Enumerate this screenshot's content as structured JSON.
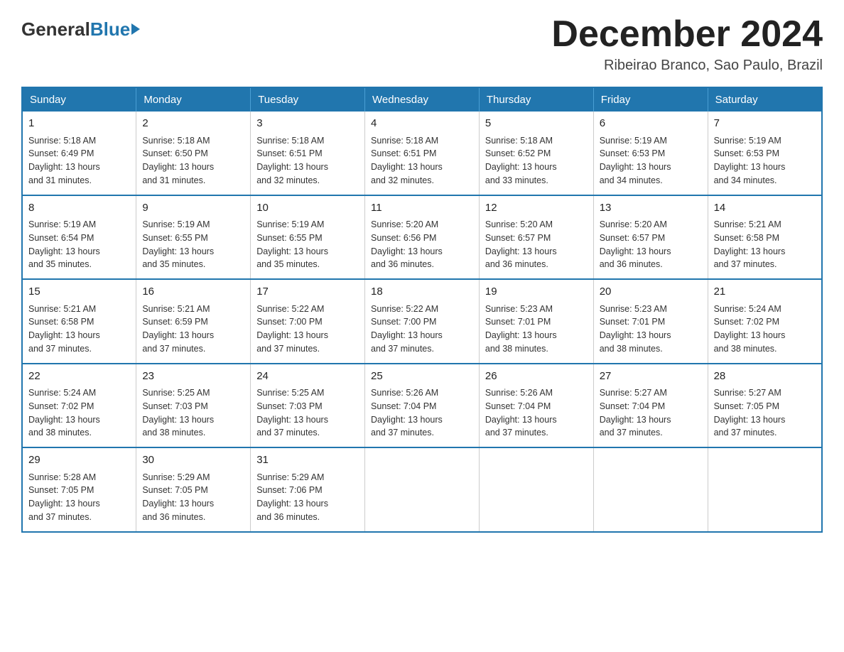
{
  "logo": {
    "general": "General",
    "blue": "Blue"
  },
  "title": "December 2024",
  "subtitle": "Ribeirao Branco, Sao Paulo, Brazil",
  "weekdays": [
    "Sunday",
    "Monday",
    "Tuesday",
    "Wednesday",
    "Thursday",
    "Friday",
    "Saturday"
  ],
  "weeks": [
    [
      {
        "day": "1",
        "sunrise": "5:18 AM",
        "sunset": "6:49 PM",
        "daylight": "13 hours and 31 minutes."
      },
      {
        "day": "2",
        "sunrise": "5:18 AM",
        "sunset": "6:50 PM",
        "daylight": "13 hours and 31 minutes."
      },
      {
        "day": "3",
        "sunrise": "5:18 AM",
        "sunset": "6:51 PM",
        "daylight": "13 hours and 32 minutes."
      },
      {
        "day": "4",
        "sunrise": "5:18 AM",
        "sunset": "6:51 PM",
        "daylight": "13 hours and 32 minutes."
      },
      {
        "day": "5",
        "sunrise": "5:18 AM",
        "sunset": "6:52 PM",
        "daylight": "13 hours and 33 minutes."
      },
      {
        "day": "6",
        "sunrise": "5:19 AM",
        "sunset": "6:53 PM",
        "daylight": "13 hours and 34 minutes."
      },
      {
        "day": "7",
        "sunrise": "5:19 AM",
        "sunset": "6:53 PM",
        "daylight": "13 hours and 34 minutes."
      }
    ],
    [
      {
        "day": "8",
        "sunrise": "5:19 AM",
        "sunset": "6:54 PM",
        "daylight": "13 hours and 35 minutes."
      },
      {
        "day": "9",
        "sunrise": "5:19 AM",
        "sunset": "6:55 PM",
        "daylight": "13 hours and 35 minutes."
      },
      {
        "day": "10",
        "sunrise": "5:19 AM",
        "sunset": "6:55 PM",
        "daylight": "13 hours and 35 minutes."
      },
      {
        "day": "11",
        "sunrise": "5:20 AM",
        "sunset": "6:56 PM",
        "daylight": "13 hours and 36 minutes."
      },
      {
        "day": "12",
        "sunrise": "5:20 AM",
        "sunset": "6:57 PM",
        "daylight": "13 hours and 36 minutes."
      },
      {
        "day": "13",
        "sunrise": "5:20 AM",
        "sunset": "6:57 PM",
        "daylight": "13 hours and 36 minutes."
      },
      {
        "day": "14",
        "sunrise": "5:21 AM",
        "sunset": "6:58 PM",
        "daylight": "13 hours and 37 minutes."
      }
    ],
    [
      {
        "day": "15",
        "sunrise": "5:21 AM",
        "sunset": "6:58 PM",
        "daylight": "13 hours and 37 minutes."
      },
      {
        "day": "16",
        "sunrise": "5:21 AM",
        "sunset": "6:59 PM",
        "daylight": "13 hours and 37 minutes."
      },
      {
        "day": "17",
        "sunrise": "5:22 AM",
        "sunset": "7:00 PM",
        "daylight": "13 hours and 37 minutes."
      },
      {
        "day": "18",
        "sunrise": "5:22 AM",
        "sunset": "7:00 PM",
        "daylight": "13 hours and 37 minutes."
      },
      {
        "day": "19",
        "sunrise": "5:23 AM",
        "sunset": "7:01 PM",
        "daylight": "13 hours and 38 minutes."
      },
      {
        "day": "20",
        "sunrise": "5:23 AM",
        "sunset": "7:01 PM",
        "daylight": "13 hours and 38 minutes."
      },
      {
        "day": "21",
        "sunrise": "5:24 AM",
        "sunset": "7:02 PM",
        "daylight": "13 hours and 38 minutes."
      }
    ],
    [
      {
        "day": "22",
        "sunrise": "5:24 AM",
        "sunset": "7:02 PM",
        "daylight": "13 hours and 38 minutes."
      },
      {
        "day": "23",
        "sunrise": "5:25 AM",
        "sunset": "7:03 PM",
        "daylight": "13 hours and 38 minutes."
      },
      {
        "day": "24",
        "sunrise": "5:25 AM",
        "sunset": "7:03 PM",
        "daylight": "13 hours and 37 minutes."
      },
      {
        "day": "25",
        "sunrise": "5:26 AM",
        "sunset": "7:04 PM",
        "daylight": "13 hours and 37 minutes."
      },
      {
        "day": "26",
        "sunrise": "5:26 AM",
        "sunset": "7:04 PM",
        "daylight": "13 hours and 37 minutes."
      },
      {
        "day": "27",
        "sunrise": "5:27 AM",
        "sunset": "7:04 PM",
        "daylight": "13 hours and 37 minutes."
      },
      {
        "day": "28",
        "sunrise": "5:27 AM",
        "sunset": "7:05 PM",
        "daylight": "13 hours and 37 minutes."
      }
    ],
    [
      {
        "day": "29",
        "sunrise": "5:28 AM",
        "sunset": "7:05 PM",
        "daylight": "13 hours and 37 minutes."
      },
      {
        "day": "30",
        "sunrise": "5:29 AM",
        "sunset": "7:05 PM",
        "daylight": "13 hours and 36 minutes."
      },
      {
        "day": "31",
        "sunrise": "5:29 AM",
        "sunset": "7:06 PM",
        "daylight": "13 hours and 36 minutes."
      },
      null,
      null,
      null,
      null
    ]
  ]
}
